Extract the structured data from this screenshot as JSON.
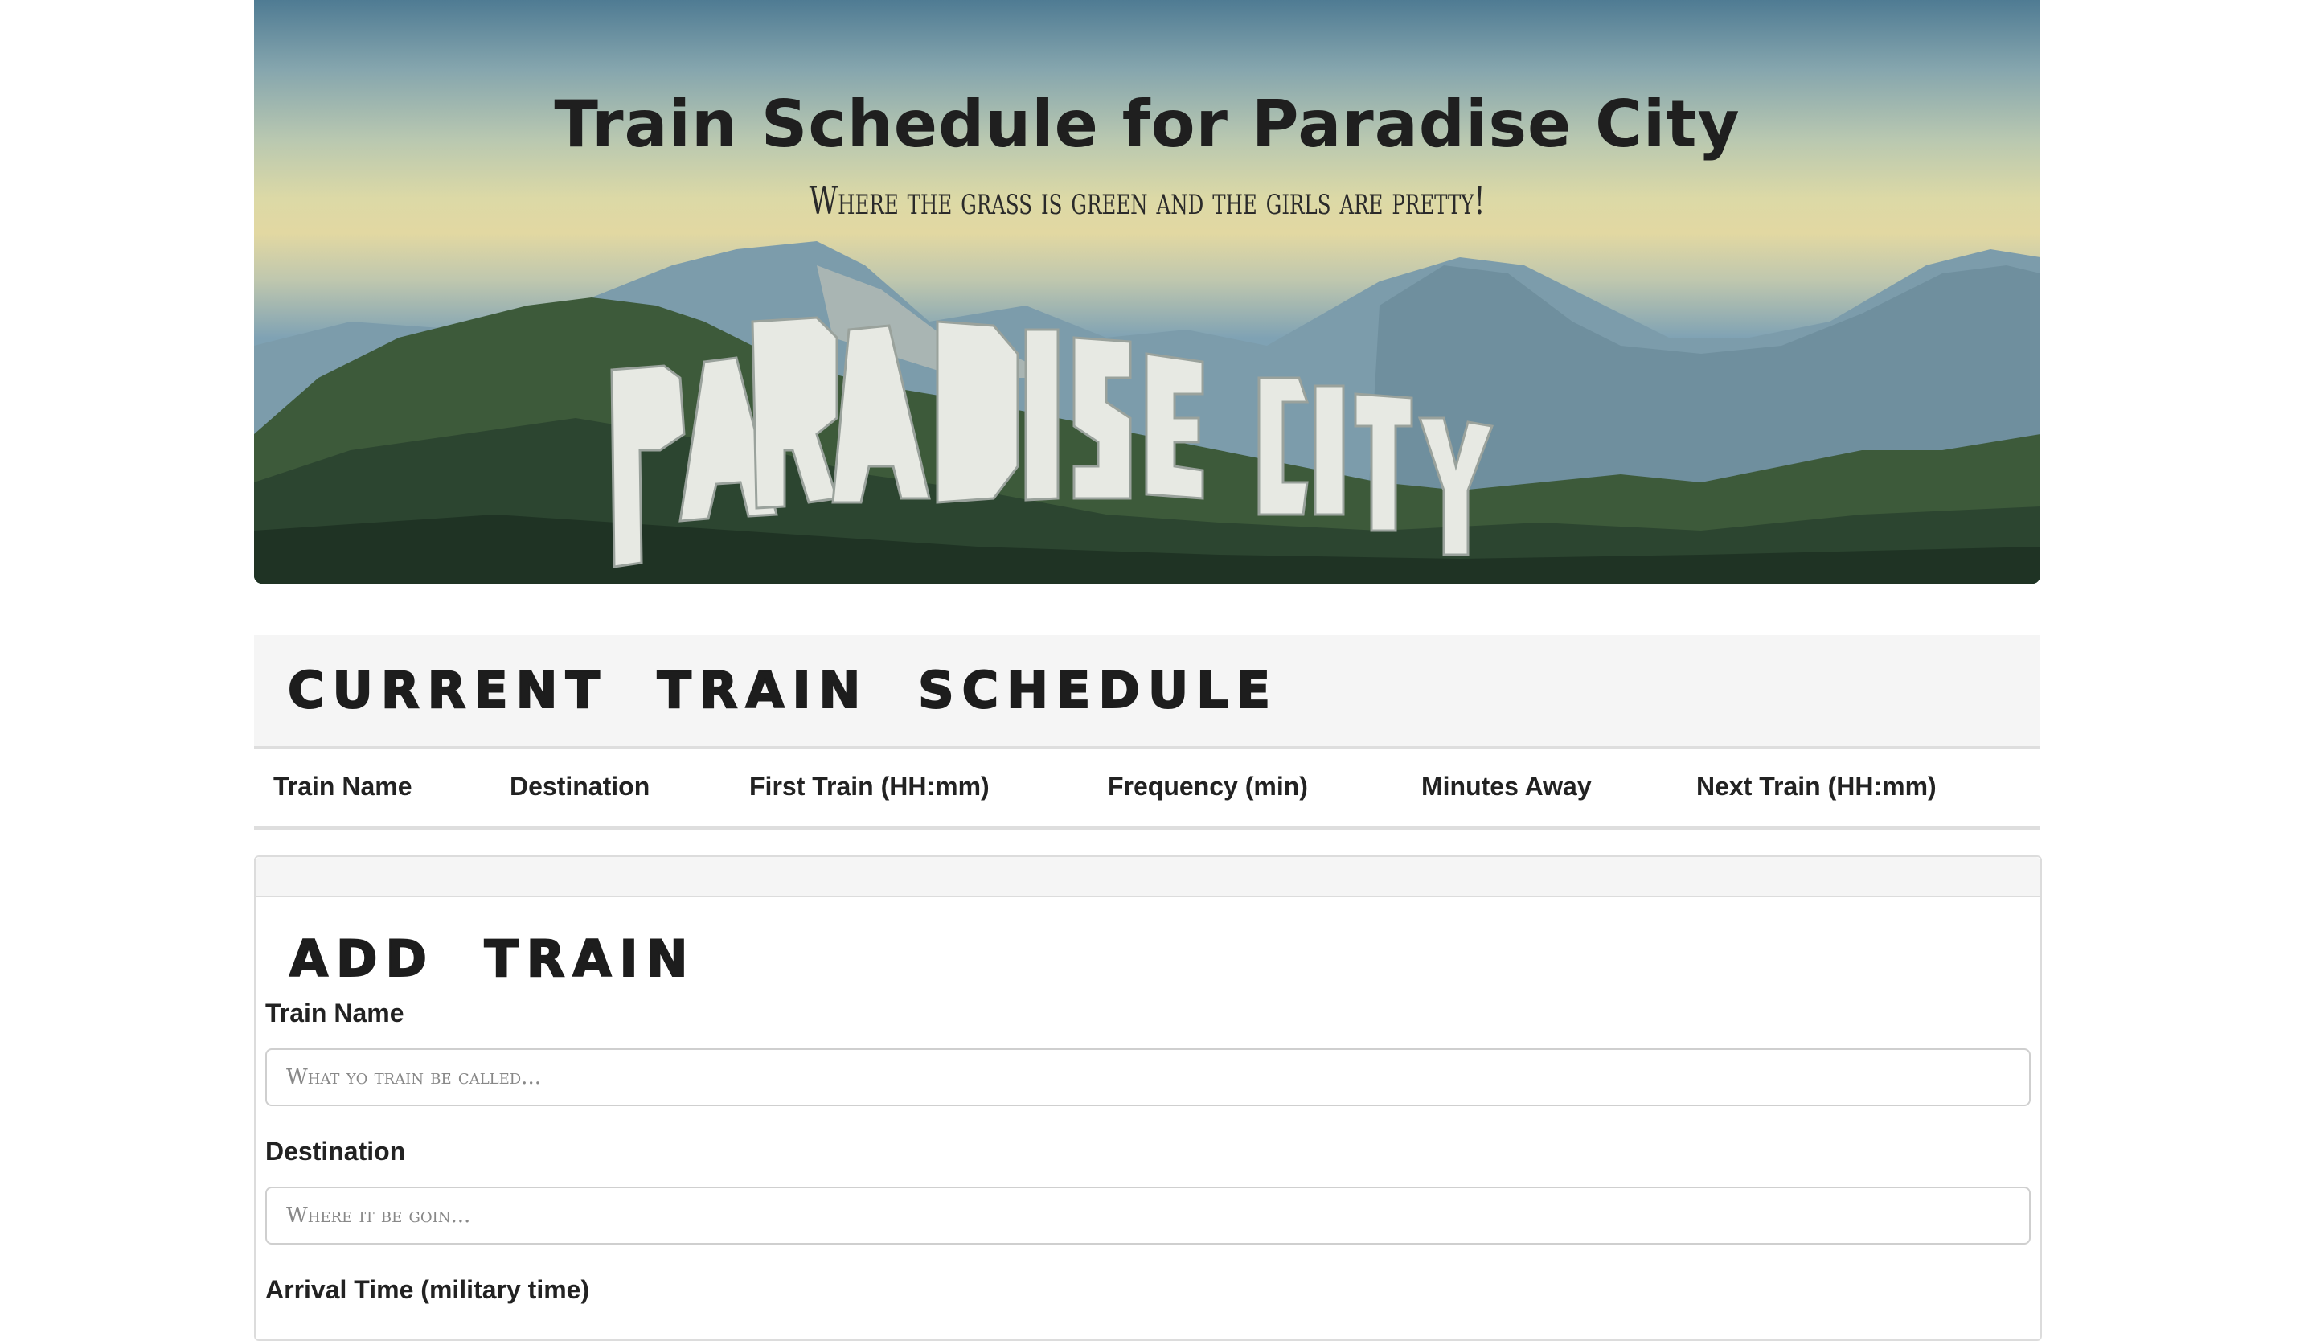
{
  "hero": {
    "title": "Train Schedule for Paradise City",
    "subtitle": "Where the grass is green and the girls are pretty!",
    "sign_text": "PARADISE CITY"
  },
  "schedule": {
    "heading": "CURRENT TRAIN SCHEDULE",
    "columns": [
      "Train Name",
      "Destination",
      "First Train (HH:mm)",
      "Frequency (min)",
      "Minutes Away",
      "Next Train (HH:mm)"
    ]
  },
  "add_train": {
    "heading": "ADD TRAIN",
    "train_name_label": "Train Name",
    "train_name_placeholder": "What yo train be called...",
    "destination_label": "Destination",
    "destination_placeholder": "Where it be goin...",
    "arrival_label": "Arrival Time (military time)"
  }
}
